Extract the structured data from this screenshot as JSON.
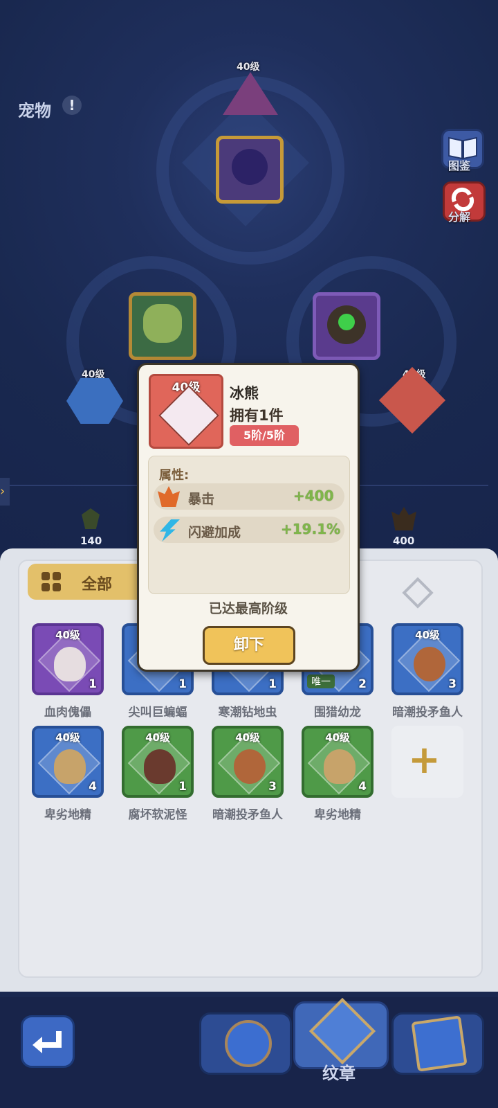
{
  "header": {
    "title": "宠物",
    "warn_glyph": "!"
  },
  "side_buttons": [
    {
      "label": "图鉴",
      "icon": "book-icon"
    },
    {
      "label": "分解",
      "icon": "recycle-icon"
    }
  ],
  "pet_slots": {
    "top_level": "40级",
    "left_level": "40级",
    "right_level": "40级"
  },
  "stats": [
    {
      "icon": "shield-stat-icon",
      "value": "140"
    },
    {
      "icon": "fire-stat-icon",
      "value": "400"
    }
  ],
  "filter": {
    "label": "全部"
  },
  "inventory": [
    {
      "level": "40级",
      "count": "1",
      "name": "血肉傀儡",
      "color": "purple"
    },
    {
      "level": "",
      "count": "1",
      "name": "尖叫巨蝙蝠",
      "color": "blue"
    },
    {
      "level": "",
      "count": "1",
      "name": "寒潮钻地虫",
      "color": "blue"
    },
    {
      "level": "",
      "count": "2",
      "name": "围猎幼龙",
      "color": "blue",
      "tag": "唯一"
    },
    {
      "level": "40级",
      "count": "3",
      "name": "暗潮投矛鱼人",
      "color": "blue"
    },
    {
      "level": "40级",
      "count": "4",
      "name": "卑劣地精",
      "color": "blue"
    },
    {
      "level": "40级",
      "count": "1",
      "name": "腐坏软泥怪",
      "color": "green"
    },
    {
      "level": "40级",
      "count": "3",
      "name": "暗潮投矛鱼人",
      "color": "green"
    },
    {
      "level": "40级",
      "count": "4",
      "name": "卑劣地精",
      "color": "green"
    }
  ],
  "add_slot": {
    "glyph": "+"
  },
  "popup": {
    "level": "40级",
    "name": "冰熊",
    "owned": "拥有1件",
    "stage": "5阶/5阶",
    "attr_title": "属性:",
    "attributes": [
      {
        "name": "暴击",
        "value": "+400"
      },
      {
        "name": "闪避加成",
        "value": "+19.1%"
      }
    ],
    "maxed_text": "已达最高阶级",
    "unequip_label": "卸下"
  },
  "nav": {
    "active_label": "纹章"
  },
  "colors": {
    "panel_bg": "#dfe3ea",
    "popup_bg": "#f7f4ec",
    "button_gold": "#f0c35a",
    "stage_red": "#e06063",
    "stat_green": "#7fb64a"
  }
}
